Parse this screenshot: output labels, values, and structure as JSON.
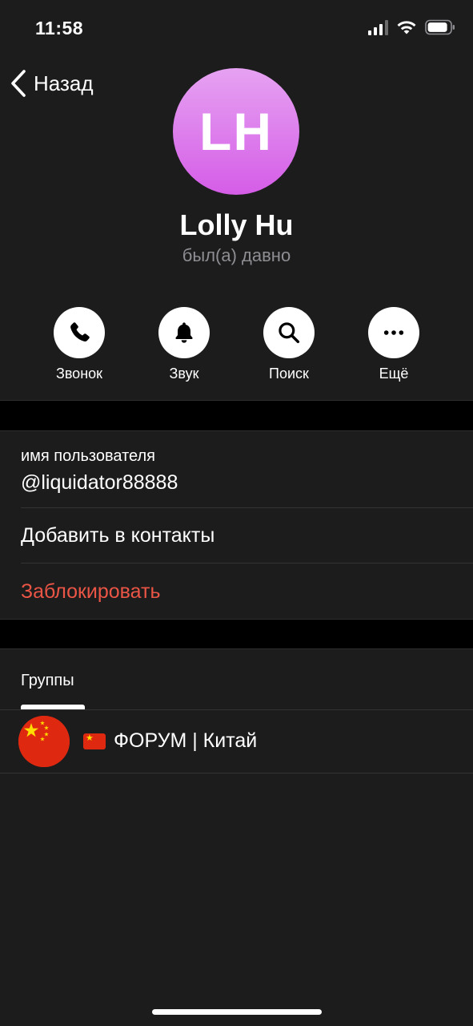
{
  "status_bar": {
    "time": "11:58"
  },
  "nav": {
    "back_label": "Назад"
  },
  "profile": {
    "initials": "LH",
    "name": "Lolly Hu",
    "status": "был(а) давно",
    "avatar_gradient": [
      "#e6a2f2",
      "#d55de7"
    ]
  },
  "actions": [
    {
      "label": "Звонок",
      "icon": "phone-icon"
    },
    {
      "label": "Звук",
      "icon": "bell-icon"
    },
    {
      "label": "Поиск",
      "icon": "search-icon"
    },
    {
      "label": "Ещё",
      "icon": "more-icon"
    }
  ],
  "info": {
    "username_caption": "имя пользователя",
    "username_value": "@liquidator88888",
    "add_contact_label": "Добавить в контакты",
    "block_label": "Заблокировать"
  },
  "groups": {
    "header": "Группы",
    "items": [
      {
        "title": "ФОРУМ | Китай",
        "icon": "china-flag-icon"
      }
    ]
  },
  "colors": {
    "background": "#1c1c1d",
    "separator": "#000000",
    "destructive": "#eb5545",
    "secondary_text": "#8e8e93"
  }
}
